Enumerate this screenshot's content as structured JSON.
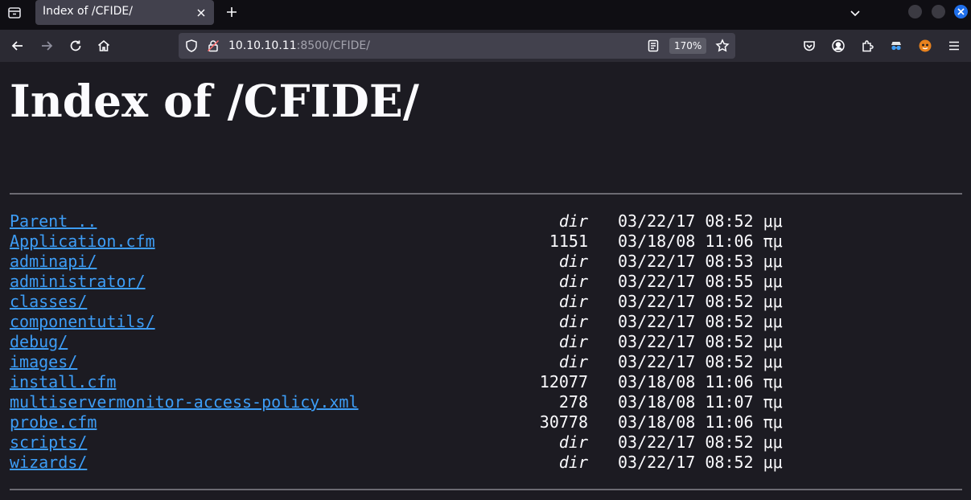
{
  "browser": {
    "tab_title": "Index of /CFIDE/",
    "url_host": "10.10.10.11",
    "url_path": ":8500/CFIDE/",
    "zoom": "170%"
  },
  "page": {
    "heading": "Index of /CFIDE/",
    "entries": [
      {
        "name": "Parent ..",
        "size": "dir",
        "date": "03/22/17 08:52 μμ"
      },
      {
        "name": "Application.cfm",
        "size": "1151",
        "date": "03/18/08 11:06 πμ"
      },
      {
        "name": "adminapi/",
        "size": "dir",
        "date": "03/22/17 08:53 μμ"
      },
      {
        "name": "administrator/",
        "size": "dir",
        "date": "03/22/17 08:55 μμ"
      },
      {
        "name": "classes/",
        "size": "dir",
        "date": "03/22/17 08:52 μμ"
      },
      {
        "name": "componentutils/",
        "size": "dir",
        "date": "03/22/17 08:52 μμ"
      },
      {
        "name": "debug/",
        "size": "dir",
        "date": "03/22/17 08:52 μμ"
      },
      {
        "name": "images/",
        "size": "dir",
        "date": "03/22/17 08:52 μμ"
      },
      {
        "name": "install.cfm",
        "size": "12077",
        "date": "03/18/08 11:06 πμ"
      },
      {
        "name": "multiservermonitor-access-policy.xml",
        "size": "278",
        "date": "03/18/08 11:07 πμ"
      },
      {
        "name": "probe.cfm",
        "size": "30778",
        "date": "03/18/08 11:06 πμ"
      },
      {
        "name": "scripts/",
        "size": "dir",
        "date": "03/22/17 08:52 μμ"
      },
      {
        "name": "wizards/",
        "size": "dir",
        "date": "03/22/17 08:52 μμ"
      }
    ]
  }
}
